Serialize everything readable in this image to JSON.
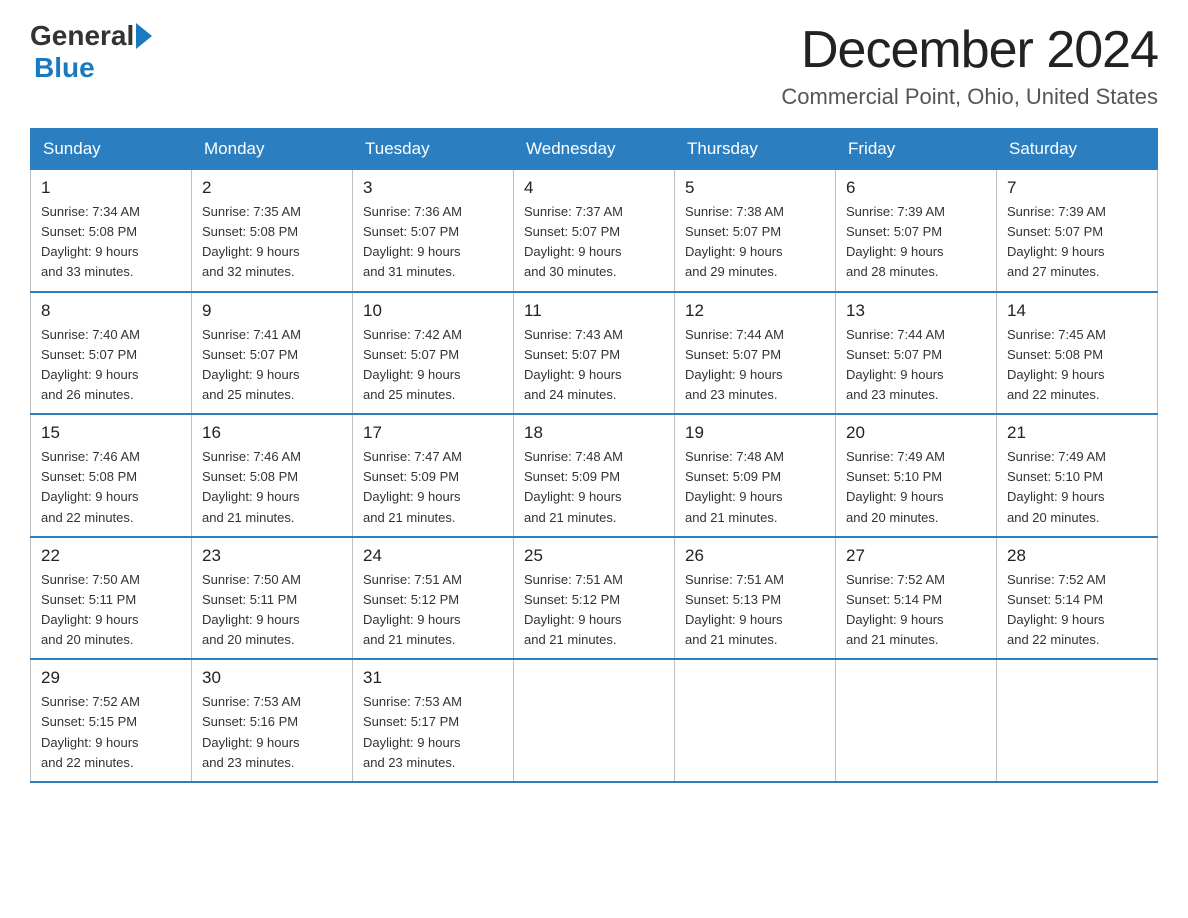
{
  "header": {
    "logo_general": "General",
    "logo_blue": "Blue",
    "month_title": "December 2024",
    "location": "Commercial Point, Ohio, United States"
  },
  "days_of_week": [
    "Sunday",
    "Monday",
    "Tuesday",
    "Wednesday",
    "Thursday",
    "Friday",
    "Saturday"
  ],
  "weeks": [
    [
      {
        "day": "1",
        "sunrise": "7:34 AM",
        "sunset": "5:08 PM",
        "daylight": "9 hours and 33 minutes."
      },
      {
        "day": "2",
        "sunrise": "7:35 AM",
        "sunset": "5:08 PM",
        "daylight": "9 hours and 32 minutes."
      },
      {
        "day": "3",
        "sunrise": "7:36 AM",
        "sunset": "5:07 PM",
        "daylight": "9 hours and 31 minutes."
      },
      {
        "day": "4",
        "sunrise": "7:37 AM",
        "sunset": "5:07 PM",
        "daylight": "9 hours and 30 minutes."
      },
      {
        "day": "5",
        "sunrise": "7:38 AM",
        "sunset": "5:07 PM",
        "daylight": "9 hours and 29 minutes."
      },
      {
        "day": "6",
        "sunrise": "7:39 AM",
        "sunset": "5:07 PM",
        "daylight": "9 hours and 28 minutes."
      },
      {
        "day": "7",
        "sunrise": "7:39 AM",
        "sunset": "5:07 PM",
        "daylight": "9 hours and 27 minutes."
      }
    ],
    [
      {
        "day": "8",
        "sunrise": "7:40 AM",
        "sunset": "5:07 PM",
        "daylight": "9 hours and 26 minutes."
      },
      {
        "day": "9",
        "sunrise": "7:41 AM",
        "sunset": "5:07 PM",
        "daylight": "9 hours and 25 minutes."
      },
      {
        "day": "10",
        "sunrise": "7:42 AM",
        "sunset": "5:07 PM",
        "daylight": "9 hours and 25 minutes."
      },
      {
        "day": "11",
        "sunrise": "7:43 AM",
        "sunset": "5:07 PM",
        "daylight": "9 hours and 24 minutes."
      },
      {
        "day": "12",
        "sunrise": "7:44 AM",
        "sunset": "5:07 PM",
        "daylight": "9 hours and 23 minutes."
      },
      {
        "day": "13",
        "sunrise": "7:44 AM",
        "sunset": "5:07 PM",
        "daylight": "9 hours and 23 minutes."
      },
      {
        "day": "14",
        "sunrise": "7:45 AM",
        "sunset": "5:08 PM",
        "daylight": "9 hours and 22 minutes."
      }
    ],
    [
      {
        "day": "15",
        "sunrise": "7:46 AM",
        "sunset": "5:08 PM",
        "daylight": "9 hours and 22 minutes."
      },
      {
        "day": "16",
        "sunrise": "7:46 AM",
        "sunset": "5:08 PM",
        "daylight": "9 hours and 21 minutes."
      },
      {
        "day": "17",
        "sunrise": "7:47 AM",
        "sunset": "5:09 PM",
        "daylight": "9 hours and 21 minutes."
      },
      {
        "day": "18",
        "sunrise": "7:48 AM",
        "sunset": "5:09 PM",
        "daylight": "9 hours and 21 minutes."
      },
      {
        "day": "19",
        "sunrise": "7:48 AM",
        "sunset": "5:09 PM",
        "daylight": "9 hours and 21 minutes."
      },
      {
        "day": "20",
        "sunrise": "7:49 AM",
        "sunset": "5:10 PM",
        "daylight": "9 hours and 20 minutes."
      },
      {
        "day": "21",
        "sunrise": "7:49 AM",
        "sunset": "5:10 PM",
        "daylight": "9 hours and 20 minutes."
      }
    ],
    [
      {
        "day": "22",
        "sunrise": "7:50 AM",
        "sunset": "5:11 PM",
        "daylight": "9 hours and 20 minutes."
      },
      {
        "day": "23",
        "sunrise": "7:50 AM",
        "sunset": "5:11 PM",
        "daylight": "9 hours and 20 minutes."
      },
      {
        "day": "24",
        "sunrise": "7:51 AM",
        "sunset": "5:12 PM",
        "daylight": "9 hours and 21 minutes."
      },
      {
        "day": "25",
        "sunrise": "7:51 AM",
        "sunset": "5:12 PM",
        "daylight": "9 hours and 21 minutes."
      },
      {
        "day": "26",
        "sunrise": "7:51 AM",
        "sunset": "5:13 PM",
        "daylight": "9 hours and 21 minutes."
      },
      {
        "day": "27",
        "sunrise": "7:52 AM",
        "sunset": "5:14 PM",
        "daylight": "9 hours and 21 minutes."
      },
      {
        "day": "28",
        "sunrise": "7:52 AM",
        "sunset": "5:14 PM",
        "daylight": "9 hours and 22 minutes."
      }
    ],
    [
      {
        "day": "29",
        "sunrise": "7:52 AM",
        "sunset": "5:15 PM",
        "daylight": "9 hours and 22 minutes."
      },
      {
        "day": "30",
        "sunrise": "7:53 AM",
        "sunset": "5:16 PM",
        "daylight": "9 hours and 23 minutes."
      },
      {
        "day": "31",
        "sunrise": "7:53 AM",
        "sunset": "5:17 PM",
        "daylight": "9 hours and 23 minutes."
      },
      null,
      null,
      null,
      null
    ]
  ],
  "labels": {
    "sunrise_prefix": "Sunrise: ",
    "sunset_prefix": "Sunset: ",
    "daylight_prefix": "Daylight: "
  }
}
